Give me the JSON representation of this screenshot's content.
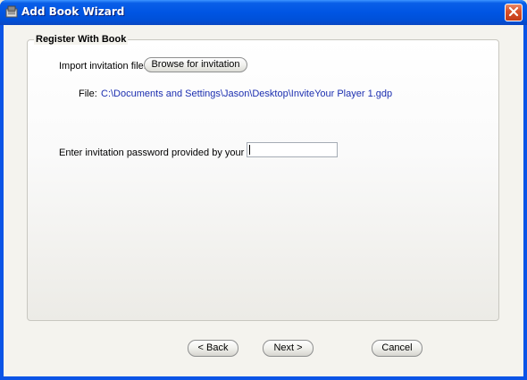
{
  "window": {
    "title": "Add Book Wizard",
    "title_icon": "wizard-app-icon",
    "close_icon": "close-icon"
  },
  "group": {
    "title": "Register With Book"
  },
  "import": {
    "label": "Import invitation file:",
    "browse_button_label": "Browse for invitation"
  },
  "file": {
    "label": "File:",
    "path": "C:\\Documents and Settings\\Jason\\Desktop\\InviteYour Player 1.gdp"
  },
  "password": {
    "label": "Enter invitation password provided by your book:",
    "value": ""
  },
  "footer": {
    "back_label": "< Back",
    "next_label": "Next >",
    "cancel_label": "Cancel"
  },
  "colors": {
    "titlebar": "#0055e3",
    "client_background": "#f4f3ee",
    "file_path_text": "#1c2fb0",
    "close_button": "#d9522c"
  }
}
